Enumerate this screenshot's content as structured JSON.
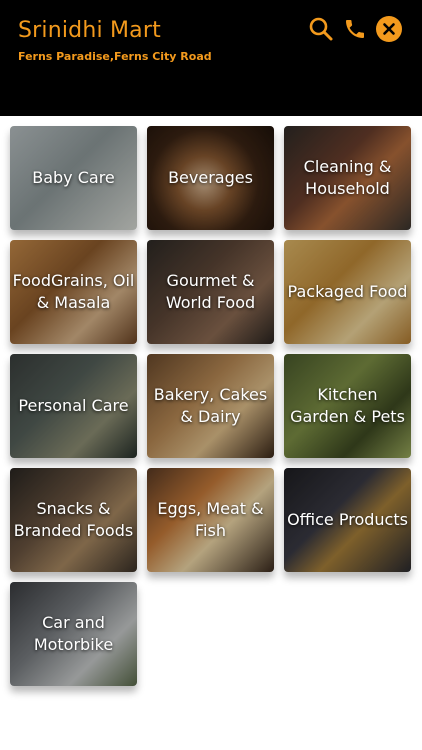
{
  "header": {
    "store_name": "Srinidhi Mart",
    "store_address": "Ferns Paradise,Ferns City Road",
    "accent_color": "#f39a1d",
    "icons": [
      "search-icon",
      "phone-icon",
      "close-icon"
    ]
  },
  "categories": [
    {
      "id": "baby-care",
      "label": "Baby Care",
      "bg": "linear-gradient(135deg,#b9c1c3 0%,#8f9a9b 45%,#d9dcd6 100%)"
    },
    {
      "id": "beverages",
      "label": "Beverages",
      "bg": "radial-gradient(circle at 45% 55%,#d9b996 0%,#8a5a32 30%,#3b2414 60%,#1e120a 100%)"
    },
    {
      "id": "cleaning-household",
      "label": "Cleaning & Household",
      "bg": "linear-gradient(135deg,#2f2b28 0%,#6a3e2c 40%,#b46d3d 60%,#3a3530 100%)"
    },
    {
      "id": "foodgrains-oil-masala",
      "label": "FoodGrains, Oil & Masala",
      "bg": "linear-gradient(135deg,#c58a4a 0%,#8d5a2b 40%,#d8b48a 70%,#6c4424 100%)"
    },
    {
      "id": "gourmet-world-food",
      "label": "Gourmet & World Food",
      "bg": "linear-gradient(135deg,#2e2a26 0%,#5d4637 40%,#8d6b53 70%,#2a2420 100%)"
    },
    {
      "id": "packaged-food",
      "label": "Packaged Food",
      "bg": "linear-gradient(135deg,#e0b869 0%,#c08a38 40%,#f0d79d 70%,#b27b30 100%)"
    },
    {
      "id": "personal-care",
      "label": "Personal Care",
      "bg": "linear-gradient(135deg,#3a3f3d 0%,#55605a 40%,#8e8f74 70%,#26302b 100%)"
    },
    {
      "id": "bakery-cakes-dairy",
      "label": "Bakery, Cakes & Dairy",
      "bg": "linear-gradient(135deg,#6b4a2c 0%,#b98a55 40%,#e2c18c 65%,#3a2718 100%)"
    },
    {
      "id": "kitchen-garden-pets",
      "label": "Kitchen Garden & Pets",
      "bg": "linear-gradient(135deg,#4a5a2c 0%,#7d8f45 40%,#3e4a22 70%,#9bab5c 100%)"
    },
    {
      "id": "snacks-branded-foods",
      "label": "Snacks & Branded Foods",
      "bg": "linear-gradient(135deg,#2a2622 0%,#6a5440 40%,#a98962 65%,#3a3128 100%)"
    },
    {
      "id": "eggs-meat-fish",
      "label": "Eggs, Meat & Fish",
      "bg": "linear-gradient(135deg,#5a3a24 0%,#c77b3a 35%,#f0d9a8 60%,#3a2a1e 100%)"
    },
    {
      "id": "office-products",
      "label": "Office Products",
      "bg": "linear-gradient(135deg,#1e1e22 0%,#3a3a44 40%,#a8803a 60%,#2a2a30 100%)"
    },
    {
      "id": "car-motorbike",
      "label": "Car and Motorbike",
      "bg": "linear-gradient(135deg,#3a3c40 0%,#7a7e82 40%,#c9cccc 70%,#5a6a4a 100%)"
    }
  ]
}
